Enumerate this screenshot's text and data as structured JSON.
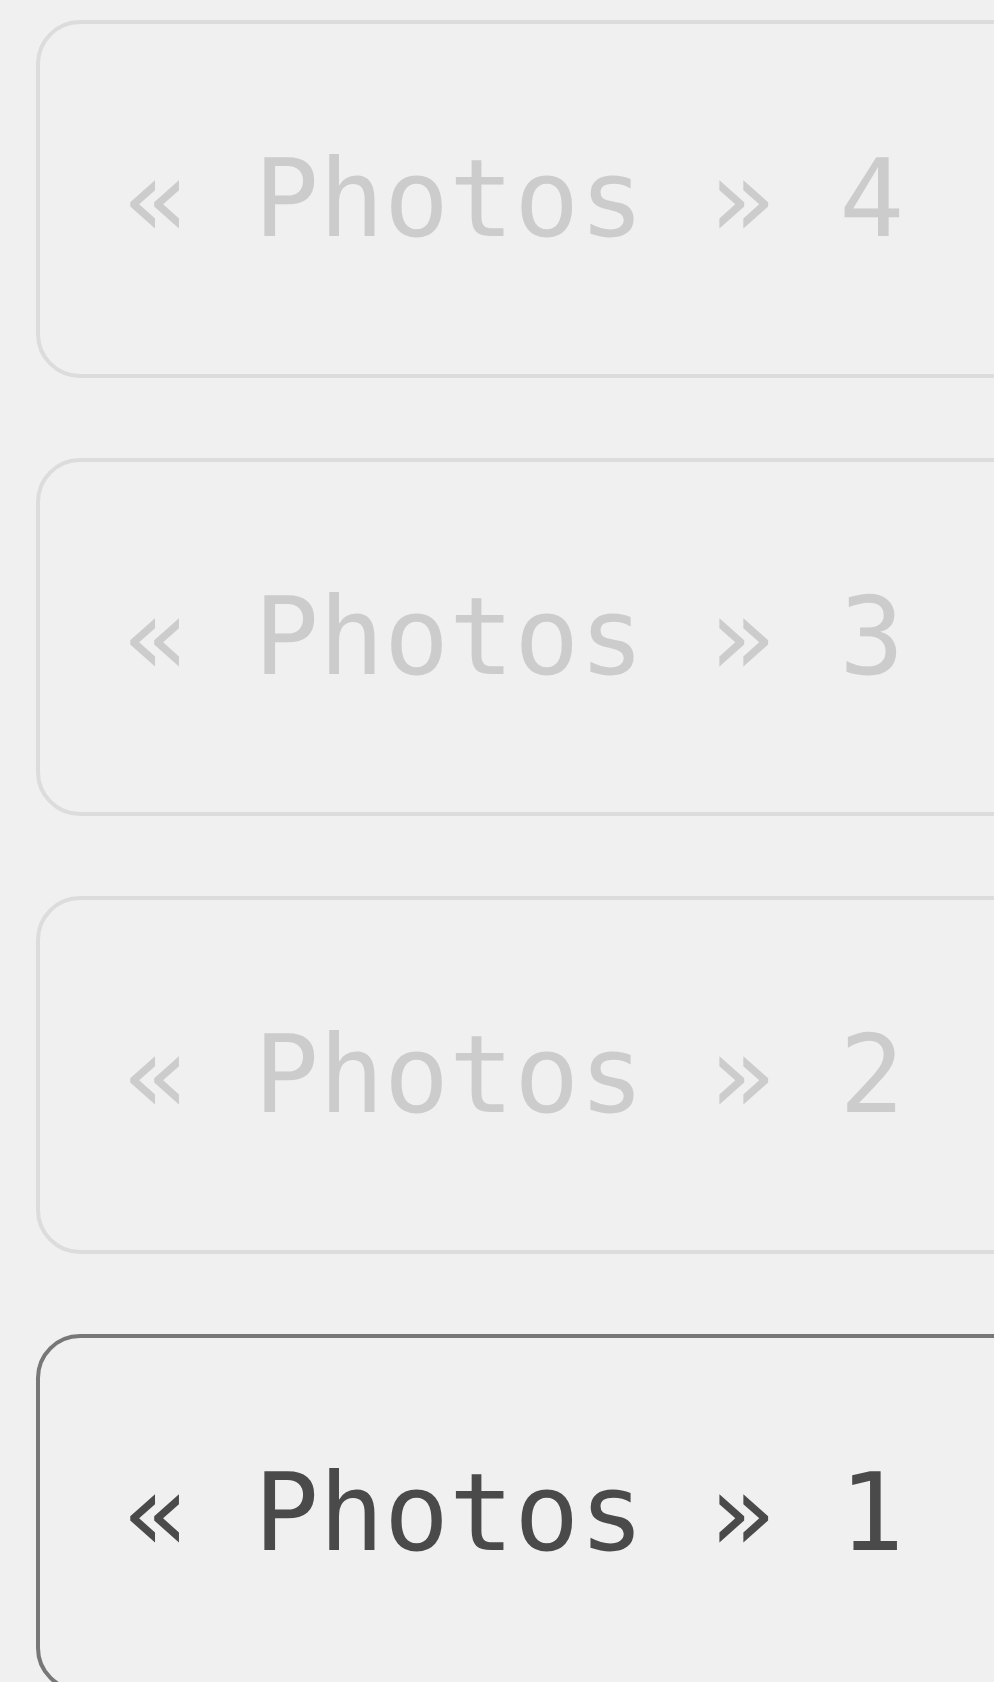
{
  "items": [
    {
      "label": "« Photos » 4",
      "selected": false
    },
    {
      "label": "« Photos » 3",
      "selected": false
    },
    {
      "label": "« Photos » 2",
      "selected": false
    },
    {
      "label": "« Photos » 1",
      "selected": true
    }
  ]
}
